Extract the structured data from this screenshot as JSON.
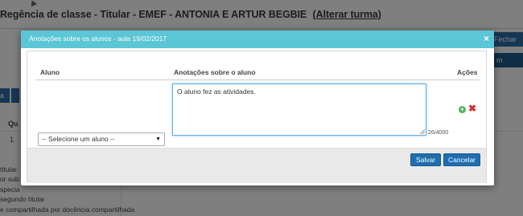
{
  "background": {
    "page_title": "Regência de classe - Titular - EMEF - ANTONIA E ARTUR BEGBIE",
    "page_title_link": "(Alterar turma)",
    "right_button_label": "Fechar",
    "right_button2_label": "m",
    "left_button_label": "a",
    "table_col_label": "Qu",
    "table_cell": "1",
    "legend_lines": [
      "titular",
      "or sub",
      "specia",
      "segundo titular",
      "e compartilhada por docência compartilhada"
    ]
  },
  "modal": {
    "title": "Anotações sobre os alunos - aula 19/02/2017",
    "close_label": "×",
    "table": {
      "headers": {
        "aluno": "Aluno",
        "anotacoes": "Anotações sobre o aluno",
        "acoes": "Ações"
      },
      "row": {
        "select_value": "-- Selecione um aluno --",
        "select_arrow": "▼",
        "note_text": "O aluno fez as atividades.",
        "counter": "26/4000",
        "add_icon": "plus-circle-icon",
        "add_glyph": "+",
        "delete_icon": "x-icon",
        "delete_glyph": "✖"
      }
    },
    "footer": {
      "save_label": "Salvar",
      "cancel_label": "Cancelar"
    }
  },
  "colors": {
    "header": "#5bc6d5",
    "primary_button": "#1e6eb0",
    "add": "#4caf50",
    "delete": "#d9302a"
  }
}
